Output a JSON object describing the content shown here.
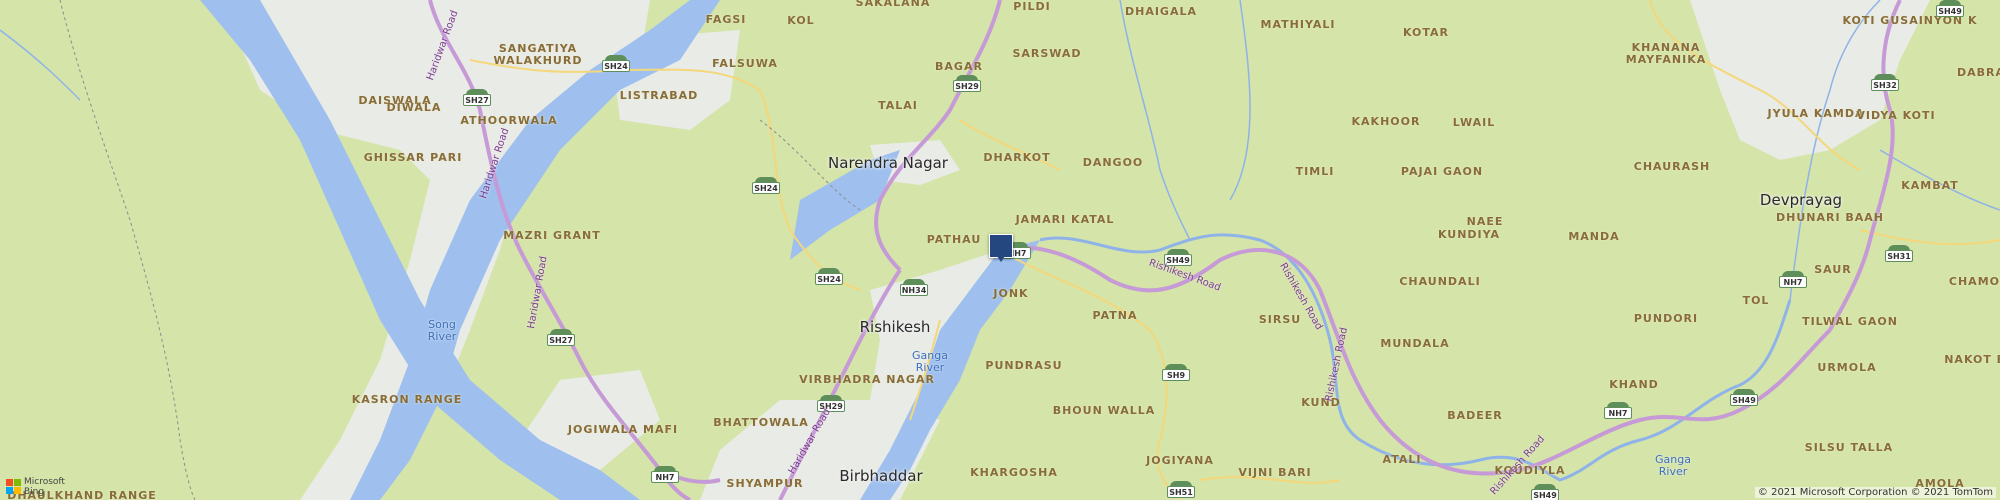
{
  "map": {
    "colors": {
      "land": "#d5e4a8",
      "urban": "#e9ebe6",
      "river": "#9fc0ee",
      "road_state": "#c59ad6",
      "road_minor": "#f4d77a"
    },
    "towns": [
      {
        "id": "narendra-nagar",
        "name": "Narendra Nagar"
      },
      {
        "id": "rishikesh",
        "name": "Rishikesh"
      },
      {
        "id": "birbhaddar",
        "name": "Birbhaddar"
      },
      {
        "id": "devprayag",
        "name": "Devprayag"
      }
    ],
    "villages": [
      {
        "id": "sakalana",
        "name": "SAKALANA"
      },
      {
        "id": "pildi",
        "name": "PILDI"
      },
      {
        "id": "dhaigala",
        "name": "DHAIGALA"
      },
      {
        "id": "mathiyali",
        "name": "MATHIYALI"
      },
      {
        "id": "kotar",
        "name": "KOTAR"
      },
      {
        "id": "koti-gusainyon",
        "name": "KOTI GUSAINYON K"
      },
      {
        "id": "fagsi",
        "name": "FAGSI"
      },
      {
        "id": "kol",
        "name": "KOL"
      },
      {
        "id": "sangatiya",
        "name": "SANGATIYA\nWALAKHURD"
      },
      {
        "id": "daiswala",
        "name": "DAISWALA"
      },
      {
        "id": "falsuwa",
        "name": "FALSUWA"
      },
      {
        "id": "bagar",
        "name": "BAGAR"
      },
      {
        "id": "sarswad",
        "name": "SARSWAD"
      },
      {
        "id": "khanana",
        "name": "KHANANA\nMAYFANIKA"
      },
      {
        "id": "dabra",
        "name": "DABRA"
      },
      {
        "id": "diwala",
        "name": "DIWALA"
      },
      {
        "id": "listrabad",
        "name": "LISTRABAD"
      },
      {
        "id": "talai",
        "name": "TALAI"
      },
      {
        "id": "athoorwala",
        "name": "ATHOORWALA"
      },
      {
        "id": "jyula-kamda",
        "name": "JYULA KAMDA"
      },
      {
        "id": "vidya-koti",
        "name": "VIDYA KOTI"
      },
      {
        "id": "kakhoor",
        "name": "KAKHOOR"
      },
      {
        "id": "lwail",
        "name": "LWAIL"
      },
      {
        "id": "ghissar-pari",
        "name": "GHISSAR PARI"
      },
      {
        "id": "dharkot",
        "name": "DHARKOT"
      },
      {
        "id": "dangoo",
        "name": "DANGOO"
      },
      {
        "id": "timli",
        "name": "TIMLI"
      },
      {
        "id": "pajai-gaon",
        "name": "PAJAI GAON"
      },
      {
        "id": "chaurash",
        "name": "CHAURASH"
      },
      {
        "id": "kambat",
        "name": "KAMBAT"
      },
      {
        "id": "dhunari-baah",
        "name": "DHUNARI BAAH"
      },
      {
        "id": "jamari-katal",
        "name": "JAMARI KATAL"
      },
      {
        "id": "pathau",
        "name": "PATHAU"
      },
      {
        "id": "naee",
        "name": "NAEE"
      },
      {
        "id": "kundiya",
        "name": "KUNDIYA"
      },
      {
        "id": "manda",
        "name": "MANDA"
      },
      {
        "id": "mazri-grant",
        "name": "MAZRI GRANT"
      },
      {
        "id": "saur",
        "name": "SAUR"
      },
      {
        "id": "chamoli",
        "name": "CHAMOLI"
      },
      {
        "id": "jonk",
        "name": "JONK"
      },
      {
        "id": "patna",
        "name": "PATNA"
      },
      {
        "id": "sirsu",
        "name": "SIRSU"
      },
      {
        "id": "chaundali",
        "name": "CHAUNDALI"
      },
      {
        "id": "tol",
        "name": "TOL"
      },
      {
        "id": "pundori",
        "name": "PUNDORI"
      },
      {
        "id": "tilwal-gaon",
        "name": "TILWAL GAON"
      },
      {
        "id": "mundala",
        "name": "MUNDALA"
      },
      {
        "id": "pundrasu",
        "name": "PUNDRASU"
      },
      {
        "id": "urmola",
        "name": "URMOLA"
      },
      {
        "id": "nakot-bha",
        "name": "NAKOT BHA"
      },
      {
        "id": "virbhadra-nagar",
        "name": "VIRBHADRA NAGAR"
      },
      {
        "id": "khand",
        "name": "KHAND"
      },
      {
        "id": "kund",
        "name": "KUND"
      },
      {
        "id": "kasron-range",
        "name": "KASRON RANGE"
      },
      {
        "id": "bhoun-walla",
        "name": "BHOUN WALLA"
      },
      {
        "id": "badeer",
        "name": "BADEER"
      },
      {
        "id": "silsu-talla",
        "name": "SILSU TALLA"
      },
      {
        "id": "bhattowala",
        "name": "BHATTOWALA"
      },
      {
        "id": "jogiwala-mafi",
        "name": "JOGIWALA MAFI"
      },
      {
        "id": "jogiyana",
        "name": "JOGIYANA"
      },
      {
        "id": "atali",
        "name": "ATALI"
      },
      {
        "id": "khargosha",
        "name": "KHARGOSHA"
      },
      {
        "id": "vijni-bari",
        "name": "VIJNI BARI"
      },
      {
        "id": "koudiyla",
        "name": "KOUDIYLA"
      },
      {
        "id": "amola",
        "name": "AMOLA"
      },
      {
        "id": "shyampur",
        "name": "SHYAMPUR"
      },
      {
        "id": "dhaulkhand-range",
        "name": "DHAULKHAND RANGE"
      }
    ],
    "rivers": [
      {
        "id": "song-river",
        "name": "Song\nRiver"
      },
      {
        "id": "ganga-river-1",
        "name": "Ganga\nRiver"
      },
      {
        "id": "ganga-river-2",
        "name": "Ganga\nRiver"
      }
    ],
    "road_names": [
      {
        "id": "haridwar-rd-1",
        "name": "Haridwar Road"
      },
      {
        "id": "haridwar-rd-2",
        "name": "Haridwar Road"
      },
      {
        "id": "haridwar-rd-3",
        "name": "Haridwar Road"
      },
      {
        "id": "haridwar-rd-4",
        "name": "Haridwar Road"
      },
      {
        "id": "rishikesh-rd-1",
        "name": "Rishikesh Road"
      },
      {
        "id": "rishikesh-rd-2",
        "name": "Rishikesh Road"
      },
      {
        "id": "rishikesh-rd-3",
        "name": "Rishikesh Road"
      },
      {
        "id": "rishikesh-rd-4",
        "name": "Rishikesh Road"
      }
    ],
    "shields": [
      {
        "id": "sh49-top",
        "label": "SH49"
      },
      {
        "id": "sh24-a",
        "label": "SH24"
      },
      {
        "id": "sh27-a",
        "label": "SH27"
      },
      {
        "id": "sh29-a",
        "label": "SH29"
      },
      {
        "id": "sh32",
        "label": "SH32"
      },
      {
        "id": "sh24-b",
        "label": "SH24"
      },
      {
        "id": "nh7-a",
        "label": "NH7"
      },
      {
        "id": "sh49-a",
        "label": "SH49"
      },
      {
        "id": "sh24-c",
        "label": "SH24"
      },
      {
        "id": "nh34",
        "label": "NH34"
      },
      {
        "id": "sh31",
        "label": "SH31"
      },
      {
        "id": "nh7-b",
        "label": "NH7"
      },
      {
        "id": "sh27-b",
        "label": "SH27"
      },
      {
        "id": "sh9",
        "label": "SH9"
      },
      {
        "id": "nh7-c",
        "label": "NH7"
      },
      {
        "id": "sh49-b",
        "label": "SH49"
      },
      {
        "id": "sh29-b",
        "label": "SH29"
      },
      {
        "id": "nh7-d",
        "label": "NH7"
      },
      {
        "id": "sh51",
        "label": "SH51"
      },
      {
        "id": "sh49-c",
        "label": "SH49"
      }
    ],
    "logo": {
      "line1": "Microsoft",
      "line2": "Bing"
    },
    "copyright": "© 2021 Microsoft Corporation © 2021 TomTom"
  }
}
